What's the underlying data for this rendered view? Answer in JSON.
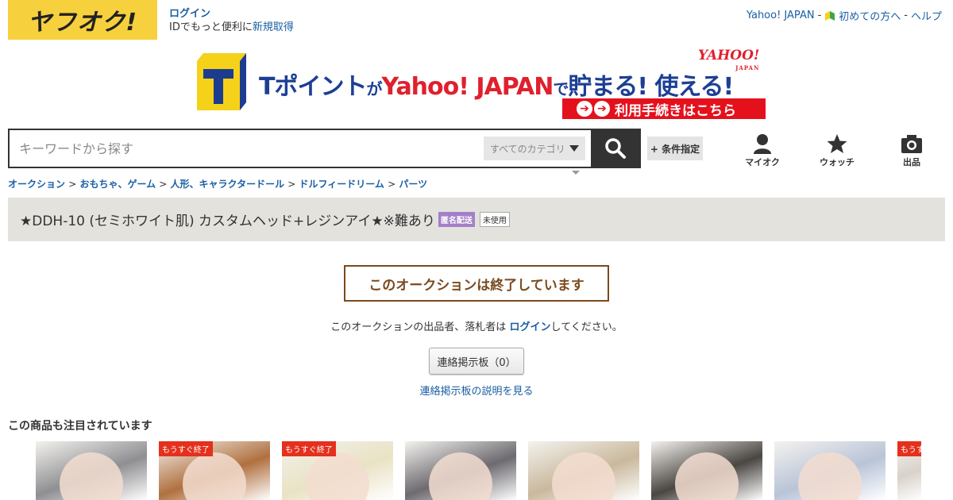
{
  "header": {
    "logo_text": "ヤフオク!",
    "login_label": "ログイン",
    "login_sub_prefix": "IDでもっと便利に",
    "register_link": "新規取得",
    "yahoo_japan_link": "Yahoo! JAPAN",
    "sep1": "-",
    "beginners_link": "初めての方へ",
    "sep2": "-",
    "help_link": "ヘルプ"
  },
  "banner": {
    "t_point": "Tポイント",
    "ga": "が",
    "yahoo_japan": "Yahoo! JAPAN",
    "de": "で",
    "tamaru": "貯まる! 使える!",
    "logo_yahoo": "YAHOO!",
    "logo_japan": "JAPAN",
    "procedure_text": "利用手続きはこちら"
  },
  "search": {
    "placeholder": "キーワードから探す",
    "category_select": "すべてのカテゴリ",
    "conditions_button": "+ 条件指定"
  },
  "nav": {
    "myauction": "マイオク",
    "watch": "ウォッチ",
    "sell": "出品"
  },
  "breadcrumb": [
    {
      "label": "オークション"
    },
    {
      "label": "おもちゃ、ゲーム"
    },
    {
      "label": "人形、キャラクタードール"
    },
    {
      "label": "ドルフィードリーム"
    },
    {
      "label": "パーツ"
    }
  ],
  "item": {
    "title": "★DDH-10 (セミホワイト肌) カスタムヘッド+レジンアイ★※難あり",
    "badge_anonymous": "匿名配送",
    "badge_unused": "未使用"
  },
  "status": {
    "ended_message": "このオークションは終了しています",
    "login_msg_prefix": "このオークションの出品者、落札者は",
    "login_msg_link": "ログイン",
    "login_msg_suffix": "してください。",
    "board_button": "連絡掲示板（0）",
    "board_help_link": "連絡掲示板の説明を見る"
  },
  "recommend": {
    "title": "この商品も注目されています",
    "items": [
      {
        "ending_soon": false,
        "color": "#8f8f93"
      },
      {
        "ending_soon": true,
        "ending_label": "もうすぐ終了",
        "color": "#b0703f"
      },
      {
        "ending_soon": true,
        "ending_label": "もうすぐ終了",
        "color": "#e9e2c4"
      },
      {
        "ending_soon": false,
        "color": "#6d6a70"
      },
      {
        "ending_soon": false,
        "color": "#c9b89c"
      },
      {
        "ending_soon": false,
        "color": "#4a4642"
      },
      {
        "ending_soon": false,
        "color": "#b9c4d8"
      },
      {
        "ending_soon": true,
        "ending_label": "もうすぐ終了",
        "color": "#d8d2ca"
      }
    ]
  },
  "colors": {
    "logo_yellow": "#f7d03e",
    "link_blue": "#1a5fa3",
    "ended_brown": "#7a4a1e",
    "anon_badge_purple": "#a47fc9",
    "ending_red": "#e4301d"
  }
}
